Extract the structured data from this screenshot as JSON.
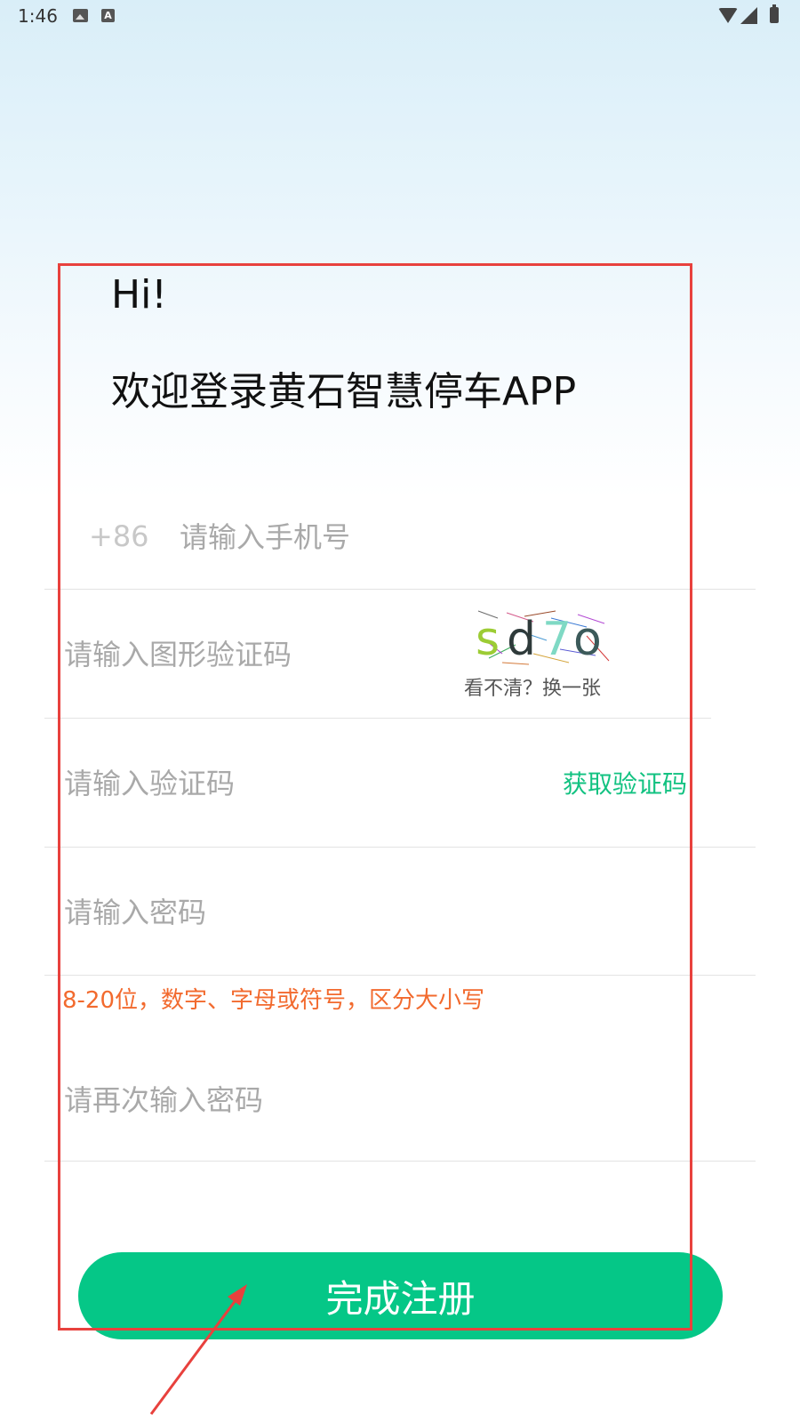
{
  "status_bar": {
    "time": "1:46",
    "icons": [
      "image-icon",
      "font-a-icon",
      "wifi-icon",
      "signal-icon",
      "battery-icon"
    ],
    "a_glyph": "A"
  },
  "greeting": {
    "hi": "Hi!",
    "welcome": "欢迎登录黄石智慧停车APP"
  },
  "form": {
    "phone_prefix": "+86",
    "phone_placeholder": "请输入手机号",
    "captcha_placeholder": "请输入图形验证码",
    "captcha_chars": [
      "s",
      "d",
      "7",
      "o"
    ],
    "captcha_refresh": "看不清？换一张",
    "code_placeholder": "请输入验证码",
    "get_code_label": "获取验证码",
    "password_placeholder": "请输入密码",
    "password_hint": "8-20位，数字、字母或符号，区分大小写",
    "confirm_password_placeholder": "请再次输入密码",
    "submit_label": "完成注册"
  },
  "colors": {
    "accent_green": "#05c787",
    "hint_orange": "#f26a2e",
    "annotation_red": "#e8413d"
  }
}
